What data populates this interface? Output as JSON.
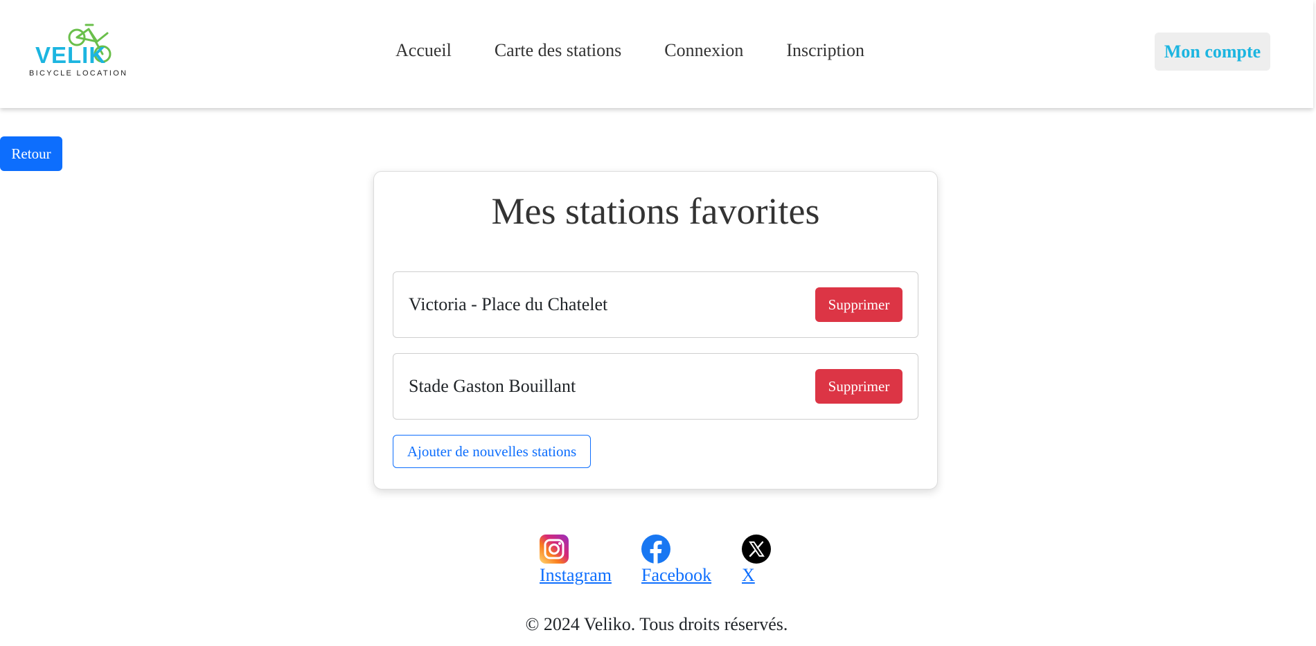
{
  "brand": {
    "name": "VELIK",
    "tagline": "BICYCLE LOCATION",
    "accent_color": "#1cb5e0",
    "bike_color": "#6abf4b"
  },
  "nav": {
    "items": [
      "Accueil",
      "Carte des stations",
      "Connexion",
      "Inscription"
    ]
  },
  "account_button": "Mon compte",
  "back_button": "Retour",
  "favorites": {
    "title": "Mes stations favorites",
    "stations": [
      {
        "name": "Victoria - Place du Chatelet",
        "delete_label": "Supprimer"
      },
      {
        "name": "Stade Gaston Bouillant",
        "delete_label": "Supprimer"
      }
    ],
    "add_label": "Ajouter de nouvelles stations"
  },
  "social": {
    "instagram": {
      "label": "Instagram",
      "icon": "instagram-icon"
    },
    "facebook": {
      "label": "Facebook",
      "icon": "facebook-icon"
    },
    "x": {
      "label": "X",
      "icon": "x-icon"
    }
  },
  "footer": {
    "copyright": "© 2024 Veliko. Tous droits réservés."
  },
  "colors": {
    "primary": "#0d6efd",
    "danger": "#dc3545"
  }
}
